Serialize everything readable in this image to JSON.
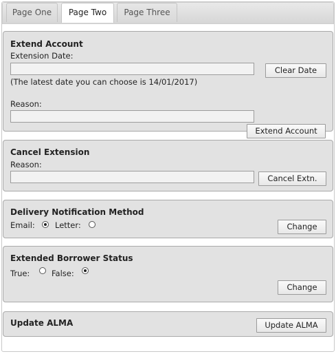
{
  "tabs": [
    {
      "label": "Page One"
    },
    {
      "label": "Page Two"
    },
    {
      "label": "Page Three"
    }
  ],
  "extend_account": {
    "title": "Extend Account",
    "date_label": "Extension Date:",
    "date_value": "",
    "clear_button": "Clear Date",
    "hint": "(The latest date you can choose is 14/01/2017)",
    "reason_label": "Reason:",
    "reason_value": "",
    "submit_button": "Extend Account"
  },
  "cancel_extension": {
    "title": "Cancel Extension",
    "reason_label": "Reason:",
    "reason_value": "",
    "button": "Cancel Extn."
  },
  "delivery": {
    "title": "Delivery Notification Method",
    "email_label": "Email:",
    "letter_label": "Letter:",
    "selected": "email",
    "button": "Change"
  },
  "borrower_status": {
    "title": "Extended Borrower Status",
    "true_label": "True:",
    "false_label": "False:",
    "selected": "false",
    "button": "Change"
  },
  "alma": {
    "title": "Update ALMA",
    "button": "Update ALMA"
  }
}
